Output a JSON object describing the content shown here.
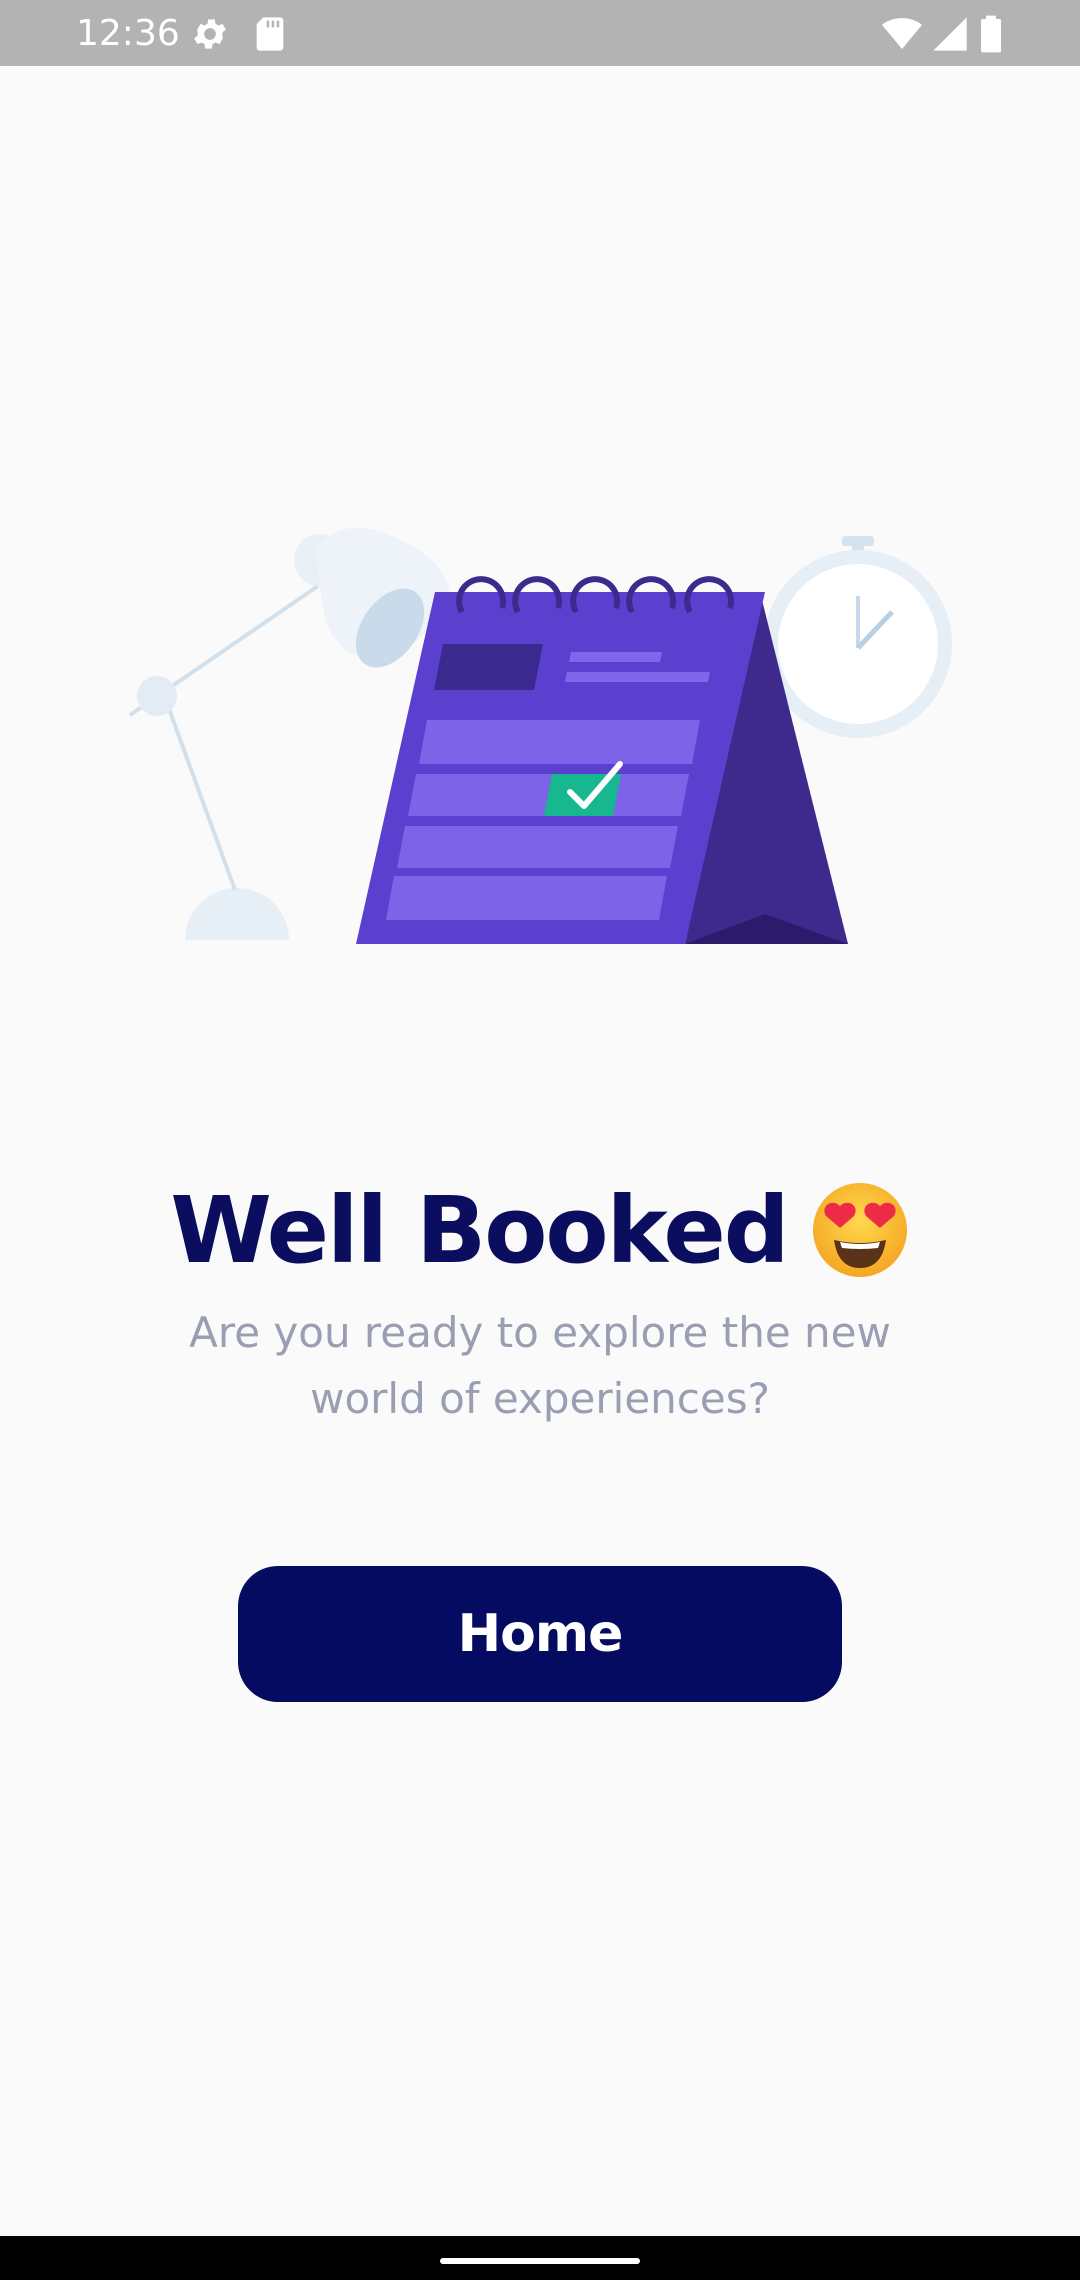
{
  "status_bar": {
    "time": "12:36",
    "left_icons": [
      "gear-icon",
      "sd-card-icon"
    ],
    "right_icons": [
      "wifi-icon",
      "signal-icon",
      "battery-icon"
    ]
  },
  "hero": {
    "illustration": "calendar-with-checkmark-lamp-stopwatch"
  },
  "content": {
    "title": "Well Booked",
    "title_emoji": "heart-eyes-emoji-icon",
    "subtitle": "Are you ready to explore the new world of experiences?"
  },
  "actions": {
    "home_label": "Home"
  },
  "colors": {
    "primary": "#050b61",
    "title": "#0b0e5e",
    "subtitle": "#9a9eb2",
    "calendar": "#5b3fcf",
    "calendar_dark": "#3d2a8c",
    "check": "#17b890",
    "background": "#fafafa",
    "status_bar": "#b3b3b3"
  }
}
